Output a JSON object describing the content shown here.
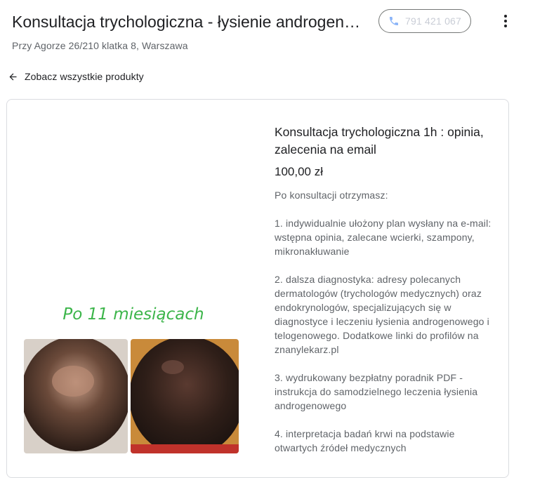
{
  "header": {
    "title": "Konsultacja trychologiczna - łysienie androgenowe",
    "phone": "791 421 067",
    "address": "Przy Agorze 26/210 klatka 8, Warszawa"
  },
  "nav": {
    "back_label": "Zobacz wszystkie produkty"
  },
  "product": {
    "name": "Konsultacja trychologiczna 1h : opinia, zalecenia na email",
    "price": "100,00 zł",
    "image_caption": "Po 11 miesiącach",
    "description": [
      "Po konsultacji otrzymasz:",
      "1. indywidualnie ułożony plan wysłany na e-mail: wstępna opinia, zalecane wcierki, szampony, mikronakłuwanie",
      "2. dalsza diagnostyka: adresy polecanych dermatologów (trychologów medycznych) oraz endokrynologów, specjalizujących się w diagnostyce i leczeniu łysienia androgenowego i telogenowego. Dodatkowe linki do profilów na znanylekarz.pl",
      "3. wydrukowany bezpłatny poradnik PDF - instrukcja do samodzielnego leczenia łysienia androgenowego",
      "4. interpretacja badań krwi na podstawie otwartych źródeł medycznych"
    ]
  },
  "colors": {
    "accent_blue": "#4285f4",
    "caption_green": "#3cb54a"
  },
  "icons": {
    "phone": "phone-icon",
    "more": "more-vert-icon",
    "back": "arrow-back-icon"
  }
}
